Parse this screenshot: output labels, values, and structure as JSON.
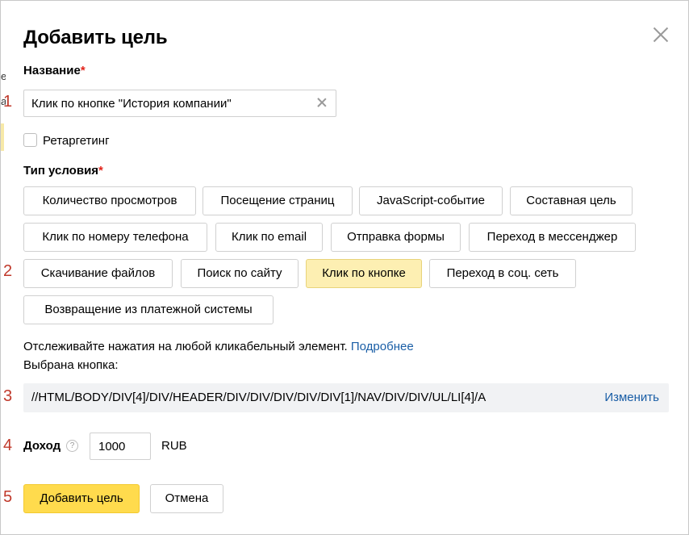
{
  "outer_page": {
    "fragment_1": "е",
    "fragment_2": "а"
  },
  "dialog": {
    "title": "Добавить цель",
    "name_label": "Название",
    "required_mark": "*",
    "name_value": "Клик по кнопке \"История компании\"",
    "retargeting_label": "Ретаргетинг",
    "condition_label": "Тип условия",
    "condition_types": [
      "Количество просмотров",
      "Посещение страниц",
      "JavaScript-событие",
      "Составная цель",
      "Клик по номеру телефона",
      "Клик по email",
      "Отправка формы",
      "Переход в мессенджер",
      "Скачивание файлов",
      "Поиск по сайту",
      "Клик по кнопке",
      "Переход в соц. сеть",
      "Возвращение из платежной системы"
    ],
    "selected_condition": "Клик по кнопке",
    "hint_text": "Отслеживайте нажатия на любой кликабельный элемент.",
    "hint_link": "Подробнее",
    "selected_button_label": "Выбрана кнопка:",
    "xpath": "//HTML/BODY/DIV[4]/DIV/HEADER/DIV/DIV/DIV/DIV/DIV[1]/NAV/DIV/DIV/UL/LI[4]/A",
    "change_link": "Изменить",
    "income_label": "Доход",
    "help_glyph": "?",
    "income_value": "1000",
    "currency": "RUB",
    "submit_label": "Добавить цель",
    "cancel_label": "Отмена"
  },
  "annotations": [
    "1",
    "2",
    "3",
    "4",
    "5"
  ],
  "colors": {
    "accent_yellow": "#ffdb4d",
    "selected_bg": "#fdefb2",
    "link": "#1a5ea6",
    "required": "#e2231a",
    "annotation": "#c0392b"
  }
}
